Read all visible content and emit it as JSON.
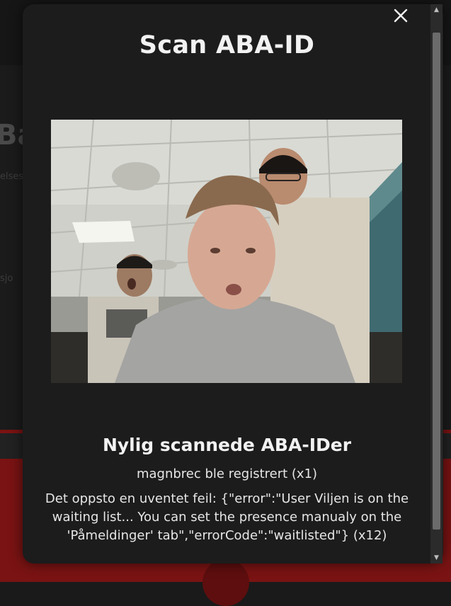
{
  "background": {
    "fragment_heading": "Ba",
    "fragment_text_1": "elsesk",
    "fragment_text_2": "sjo"
  },
  "modal": {
    "title": "Scan ABA-ID",
    "close_icon": "close-icon",
    "camera": {
      "icon": "camera-feed"
    },
    "recent": {
      "title": "Nylig scannede ABA-IDer",
      "success_message": "magnbrec ble registrert (x1)",
      "error_message": "Det oppsto en uventet feil: {\"error\":\"User Viljen is on the waiting list... You can set the presence manualy on the 'Påmeldinger' tab\",\"errorCode\":\"waitlisted\"} (x12)"
    }
  },
  "scrollbar": {
    "up_icon": "arrow-up-icon",
    "down_icon": "arrow-down-icon"
  },
  "colors": {
    "modal_background": "#1c1c1c",
    "footer_accent": "#7a1313",
    "text": "#f2f2f2"
  }
}
